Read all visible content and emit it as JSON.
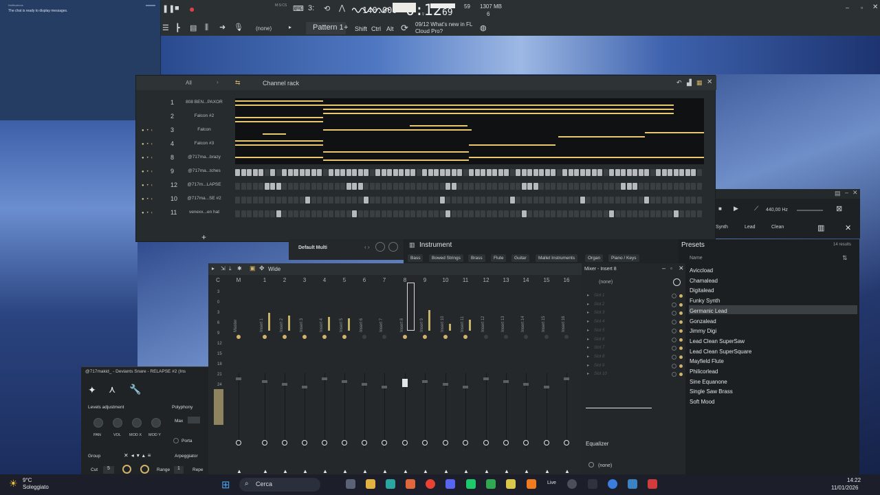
{
  "notification": {
    "app": "Notifications",
    "message": "The chat is ready to display messages."
  },
  "toolbar": {
    "tempo": "140.000",
    "time_main": "0:12",
    "time_sub": "69",
    "time_unit": "M:S:CS",
    "cpu_value": "59",
    "memory": "1307 MB",
    "voices": "6",
    "pattern": "Pattern 1",
    "shift": "Shift",
    "ctrl": "Ctrl",
    "alt": "Alt",
    "none": "(none)",
    "news_date": "09/12",
    "news_text": "What's new in FL Cloud Pro?"
  },
  "channel_rack": {
    "title": "Channel rack",
    "filter": "All",
    "channels": [
      {
        "num": "1",
        "name": "808 BEN...PAXOR"
      },
      {
        "num": "2",
        "name": "Falcon #2"
      },
      {
        "num": "3",
        "name": "Falcon"
      },
      {
        "num": "4",
        "name": "Falcon #3"
      },
      {
        "num": "8",
        "name": "@717ma...brazy"
      },
      {
        "num": "9",
        "name": "@717ma...tches"
      },
      {
        "num": "12",
        "name": "@717m...LAPSE"
      },
      {
        "num": "10",
        "name": "@717ma...SE #2"
      },
      {
        "num": "11",
        "name": "venexx...en hat"
      }
    ],
    "add": "+"
  },
  "uvi": {
    "frequency": "440,00 Hz",
    "tags": [
      "Synth",
      "Lead",
      "Clean"
    ]
  },
  "instrument_panel": {
    "title": "Instrument",
    "categories": [
      "Bass",
      "Bowed Strings",
      "Brass",
      "Flute",
      "Guitar",
      "Mallet Instruments",
      "Organ",
      "Piano / Keys"
    ]
  },
  "presets": {
    "title": "Presets",
    "count": "14 results",
    "column": "Name",
    "selected": "Germanic Lead",
    "items": [
      "Aviccload",
      "Chamalead",
      "Digitalead",
      "Funky Synth",
      "Germanic Lead",
      "Gonzalead",
      "Jimmy Digi",
      "Lead Clean SuperSaw",
      "Lead Clean SuperSquare",
      "Mayfield Flute",
      "Philicorlead",
      "Sine Equanone",
      "Single Saw Brass",
      "Soft Mood"
    ]
  },
  "multi": {
    "title": "Default Multi"
  },
  "mixer": {
    "title": "Mixer - Insert 8",
    "mode": "Wide",
    "columns": [
      "C",
      "M",
      "1",
      "2",
      "3",
      "4",
      "5",
      "6",
      "7",
      "8",
      "9",
      "10",
      "11",
      "12",
      "13",
      "14",
      "15",
      "16"
    ],
    "tracks": [
      "Master",
      "Insert 1",
      "Insert 2",
      "Insert 3",
      "Insert 4",
      "Insert 5",
      "Insert 6",
      "Insert 7",
      "Insert 8",
      "Insert 9",
      "Insert 10",
      "Insert 11",
      "Insert 12",
      "Insert 13",
      "Insert 14",
      "Insert 15",
      "Insert 16"
    ],
    "db_scale": [
      "3",
      "0",
      "3",
      "6",
      "9",
      "12",
      "15",
      "18",
      "21",
      "24"
    ],
    "insert_none": "(none)",
    "slots": [
      "Slot 1",
      "Slot 2",
      "Slot 3",
      "Slot 4",
      "Slot 5",
      "Slot 6",
      "Slot 7",
      "Slot 8",
      "Slot 9",
      "Slot 10"
    ],
    "equalizer": "Equalizer",
    "output_none": "(none)"
  },
  "sampler": {
    "title": "@717makid_ - Deviants Snare - RELAPSE #2 (Ins",
    "levels": "Levels adjustment",
    "polyphony": "Polyphony",
    "max": "Max",
    "knobs": [
      "PAN",
      "VOL",
      "MOD X",
      "MOD Y"
    ],
    "porta": "Porta",
    "group": "Group",
    "arpeggiator": "Arpeggiator",
    "cut": "Cut",
    "cut_val": "5",
    "range": "Range",
    "range_val": "1",
    "repeat": "Repe"
  },
  "taskbar": {
    "temp": "9°C",
    "weather": "Soleggiato",
    "search": "Cerca",
    "live": "Live",
    "time": "14:22",
    "date": "11/01/2026"
  }
}
